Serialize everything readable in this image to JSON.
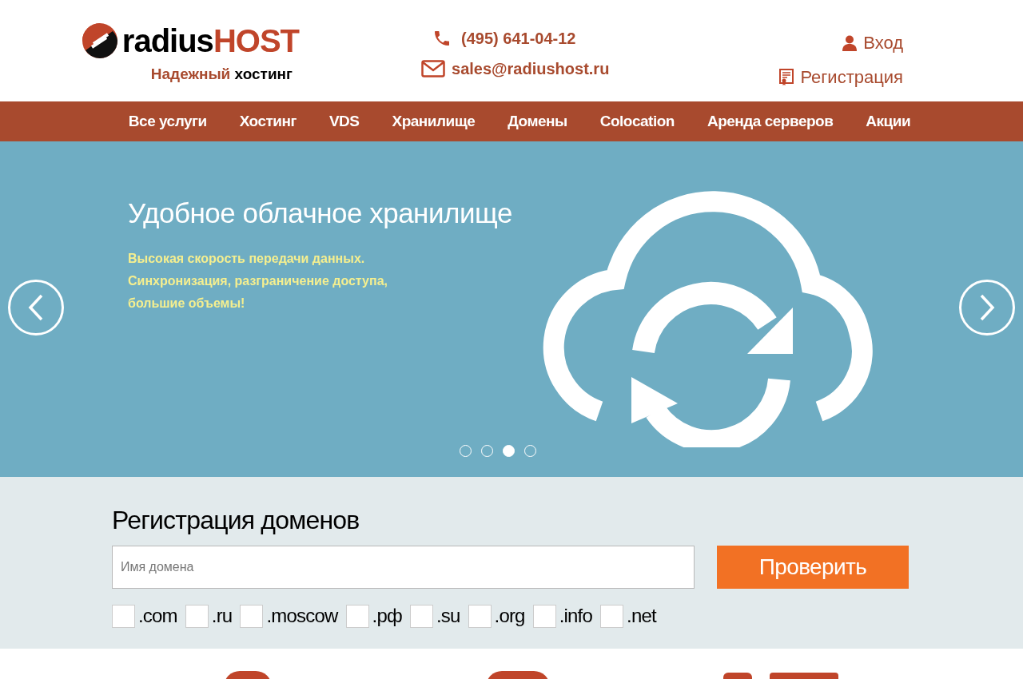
{
  "header": {
    "logo": {
      "prefix": "radius",
      "suffix": "HOST"
    },
    "tagline": {
      "prefix": "Надежный",
      "suffix": "хостинг"
    },
    "phone": "(495) 641-04-12",
    "email": "sales@radiushost.ru",
    "login": "Вход",
    "register": "Регистрация"
  },
  "nav": [
    "Все услуги",
    "Хостинг",
    "VDS",
    "Хранилище",
    "Домены",
    "Colocation",
    "Аренда серверов",
    "Акции"
  ],
  "hero": {
    "title": "Удобное облачное хранилище",
    "text": [
      "Высокая скорость передачи данных.",
      "Синхронизация, разграничение доступа,",
      "большие объемы!"
    ],
    "dots": [
      {
        "selected": false
      },
      {
        "selected": false
      },
      {
        "selected": true
      },
      {
        "selected": false
      }
    ]
  },
  "domains": {
    "title": "Регистрация доменов",
    "placeholder": "Имя домена",
    "button": "Проверить",
    "zones": [
      {
        "label": ".com",
        "checked": false
      },
      {
        "label": ".ru",
        "checked": false
      },
      {
        "label": ".moscow",
        "checked": false
      },
      {
        "label": ".рф",
        "checked": false
      },
      {
        "label": ".su",
        "checked": false
      },
      {
        "label": ".org",
        "checked": false
      },
      {
        "label": ".info",
        "checked": false
      },
      {
        "label": ".net",
        "checked": false
      }
    ]
  }
}
